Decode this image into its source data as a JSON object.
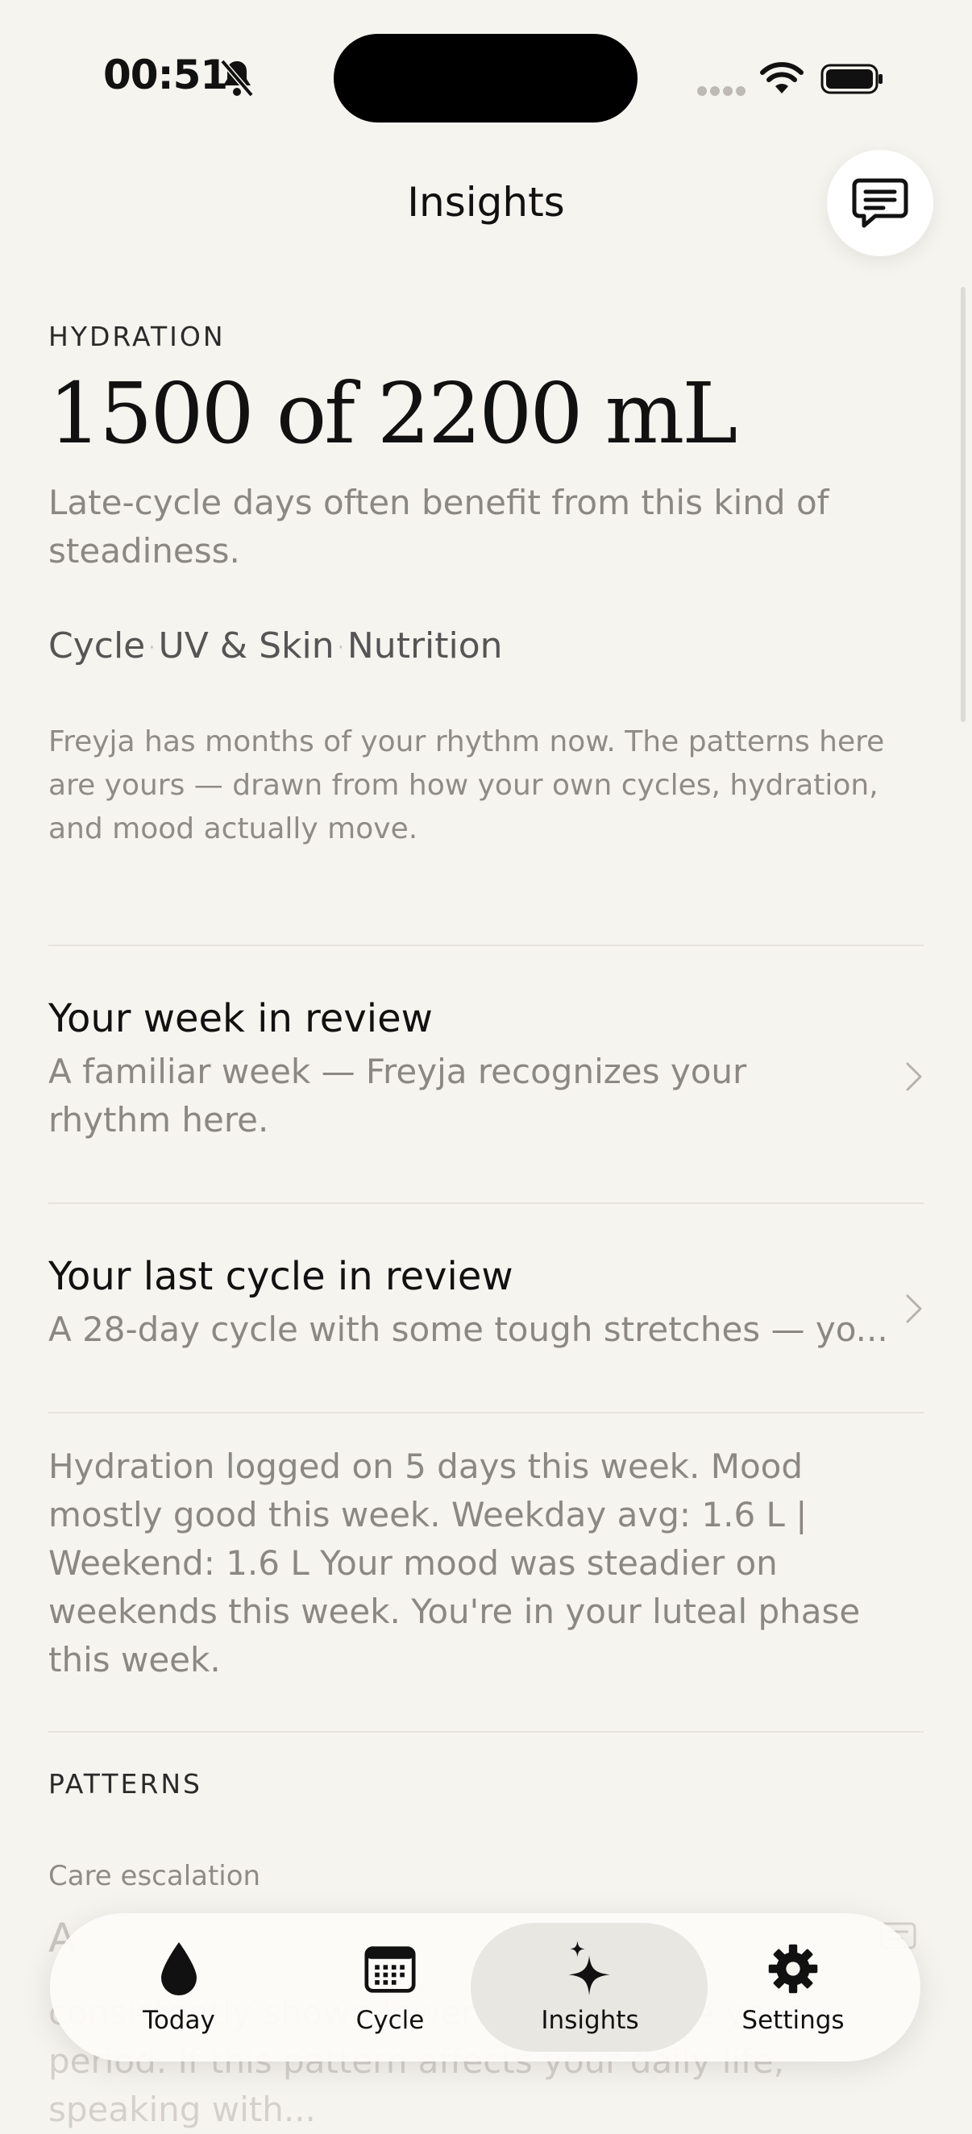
{
  "status_bar": {
    "time": "00:51"
  },
  "header": {
    "title": "Insights"
  },
  "hydration": {
    "eyebrow": "HYDRATION",
    "value": "1500 of 2200 mL",
    "description": "Late-cycle days often benefit from this kind of steadiness.",
    "tags": [
      "Cycle",
      "UV & Skin",
      "Nutrition"
    ],
    "intro": "Freyja has months of your rhythm now. The patterns here are yours — drawn from how your own cycles, hydration, and mood actually move."
  },
  "reviews": [
    {
      "title": "Your week in review",
      "subtitle": "A familiar week — Freyja recognizes your rhythm here."
    },
    {
      "title": "Your last cycle in review",
      "subtitle": "A 28-day cycle with some tough stretches — yo..."
    }
  ],
  "summary": "Hydration logged on 5 days this week. Mood mostly good this week. Weekday avg: 1.6 L | Weekend: 1.6 L Your mood was steadier on weekends this week. You're in your luteal phase this week.",
  "patterns": {
    "eyebrow": "PATTERNS",
    "care_label": "Care escalation",
    "title_fragment": "A",
    "body_fragment": "consistently shown lower scores before your period. If this pattern affects your daily life, speaking with..."
  },
  "tab_bar": {
    "tabs": [
      {
        "label": "Today",
        "icon": "drop-icon"
      },
      {
        "label": "Cycle",
        "icon": "calendar-icon"
      },
      {
        "label": "Insights",
        "icon": "sparkles-icon"
      },
      {
        "label": "Settings",
        "icon": "gear-icon"
      }
    ],
    "active": "Insights"
  },
  "colors": {
    "background": "#F6F4EF",
    "active_tab": "#E9E7E2",
    "muted_text": "#8B8883"
  }
}
